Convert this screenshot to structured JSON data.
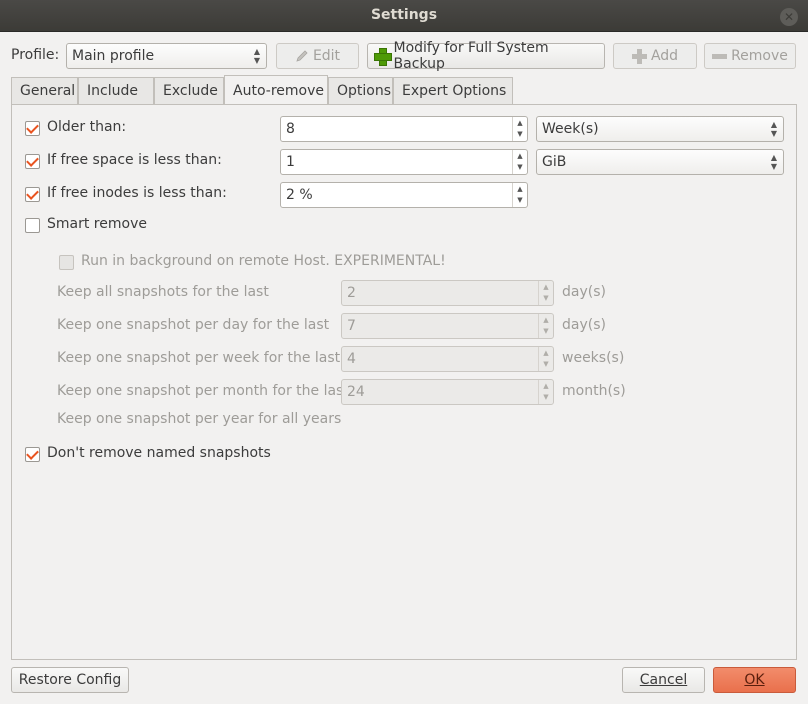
{
  "window": {
    "title": "Settings"
  },
  "profile": {
    "label": "Profile:",
    "selected": "Main profile",
    "edit_label": "Edit",
    "modify_label": "Modify for Full System Backup",
    "add_label": "Add",
    "remove_label": "Remove"
  },
  "tabs": [
    "General",
    "Include",
    "Exclude",
    "Auto-remove",
    "Options",
    "Expert Options"
  ],
  "rules": {
    "older_than": {
      "label": "Older than:",
      "value": "8",
      "unit": "Week(s)",
      "checked": true
    },
    "free_space": {
      "label": "If free space is less than:",
      "value": "1",
      "unit": "GiB",
      "checked": true
    },
    "free_inodes": {
      "label": "If free inodes is less than:",
      "value": "2 %",
      "checked": true
    }
  },
  "smart_remove": {
    "label": "Smart remove",
    "checked": false,
    "background_label": "Run in background on remote Host. EXPERIMENTAL!",
    "keep_all": {
      "label": "Keep all snapshots for the last",
      "value": "2",
      "unit": "day(s)"
    },
    "keep_day": {
      "label": "Keep one snapshot per day for the last",
      "value": "7",
      "unit": "day(s)"
    },
    "keep_week": {
      "label": "Keep one snapshot per week for the last",
      "value": "4",
      "unit": "weeks(s)"
    },
    "keep_month": {
      "label": "Keep one snapshot per month for the last",
      "value": "24",
      "unit": "month(s)"
    },
    "keep_year": "Keep one snapshot per year for all years"
  },
  "dont_remove_named": {
    "label": "Don't remove named snapshots",
    "checked": true
  },
  "footer": {
    "restore_label": "Restore Config",
    "cancel_label": "Cancel",
    "ok_label": "OK"
  },
  "colors": {
    "accent": "#e95420",
    "ok_button": "#ee7a56"
  }
}
